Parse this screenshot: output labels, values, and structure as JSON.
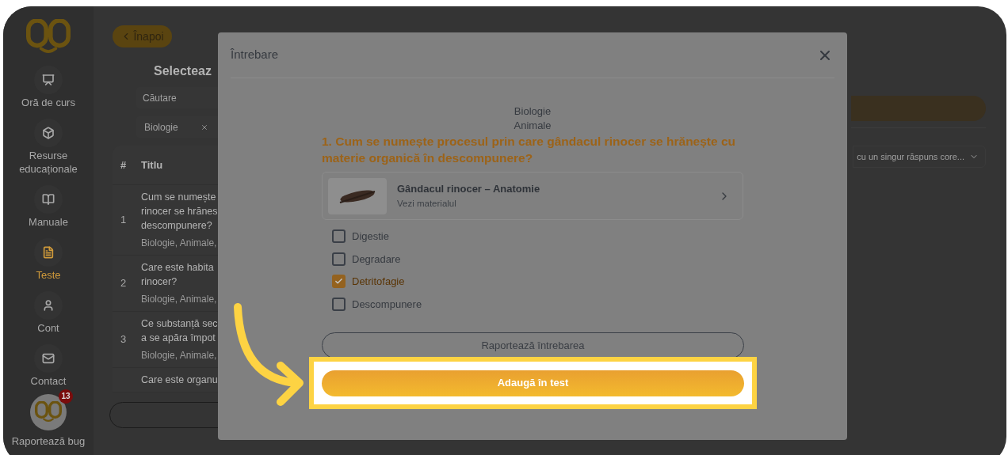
{
  "sidebar": {
    "items": [
      {
        "label": "Oră de curs",
        "selected": false,
        "kind": "lesson"
      },
      {
        "label": "Resurse educaționale",
        "selected": false,
        "kind": "resources"
      },
      {
        "label": "Manuale",
        "selected": false,
        "kind": "books"
      },
      {
        "label": "Teste",
        "selected": true,
        "kind": "tests"
      },
      {
        "label": "Cont",
        "selected": false,
        "kind": "account"
      },
      {
        "label": "Contact",
        "selected": false,
        "kind": "contact"
      }
    ],
    "bug_report": {
      "label": "Raportează bug",
      "badge": "13"
    }
  },
  "back_button": "Înapoi",
  "heading": "Selecteaz",
  "search": {
    "placeholder": "Căutare"
  },
  "filter": {
    "value": "Biologie"
  },
  "table": {
    "columns": [
      "#",
      "Titlu"
    ],
    "rows": [
      {
        "number": "1",
        "title_lines": [
          "Cum se numește",
          "rinocer se hrănes",
          "descompunere?"
        ],
        "tags": "Biologie, Animale,"
      },
      {
        "number": "2",
        "title_lines": [
          "Care este habita",
          "rinocer?"
        ],
        "tags": "Biologie, Animale,"
      },
      {
        "number": "3",
        "title_lines": [
          "Ce substanță sec",
          "a se apăra împot"
        ],
        "tags": "Biologie, Animale,"
      },
      {
        "number": "",
        "title_lines": [
          "Care este organu"
        ],
        "tags": ""
      }
    ]
  },
  "type_dropdown": {
    "value": "cu un singur răspuns core..."
  },
  "modal": {
    "title": "Întrebare",
    "subject": "Biologie",
    "topic": "Animale",
    "question": "1. Cum se numește procesul prin care gândacul rinocer se hrănește cu materie organică în descompunere?",
    "material": {
      "title": "Gândacul rinocer – Anatomie",
      "subtitle": "Vezi materialul"
    },
    "options": [
      {
        "label": "Digestie",
        "checked": false
      },
      {
        "label": "Degradare",
        "checked": false
      },
      {
        "label": "Detritofagie",
        "checked": true
      },
      {
        "label": "Descompunere",
        "checked": false
      }
    ],
    "report_button": "Raportează întrebarea",
    "add_button": "Adaugă în test"
  }
}
